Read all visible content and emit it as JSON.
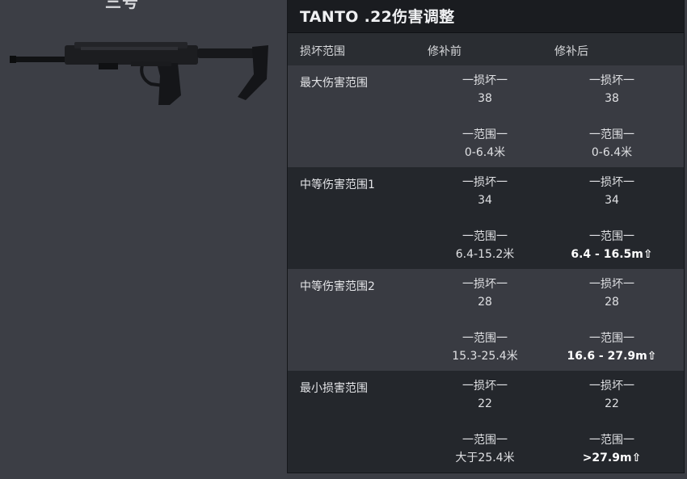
{
  "left": {
    "top_fragment": "三号"
  },
  "panel": {
    "title": "TANTO .22伤害调整",
    "headers": {
      "range": "损坏范围",
      "before": "修补前",
      "after": "修补后"
    },
    "damage_label": "一损坏一",
    "range_label": "一范围一",
    "rows": [
      {
        "label": "最大伤害范围",
        "before_damage": "38",
        "after_damage": "38",
        "before_range": "0-6.4米",
        "after_range": "0-6.4米"
      },
      {
        "label": "中等伤害范围1",
        "before_damage": "34",
        "after_damage": "34",
        "before_range": "6.4-15.2米",
        "after_range": "6.4 - 16.5m⇧"
      },
      {
        "label": "中等伤害范围2",
        "before_damage": "28",
        "after_damage": "28",
        "before_range": "15.3-25.4米",
        "after_range": "16.6 - 27.9m⇧"
      },
      {
        "label": "最小损害范围",
        "before_damage": "22",
        "after_damage": "22",
        "before_range": "大于25.4米",
        "after_range": ">27.9m⇧"
      }
    ]
  },
  "colors": {
    "background": "#3b3d44",
    "panel_dark": "#22252a",
    "row_light": "#393b42",
    "row_dark": "#24272c",
    "title_bar": "#1a1c20"
  }
}
